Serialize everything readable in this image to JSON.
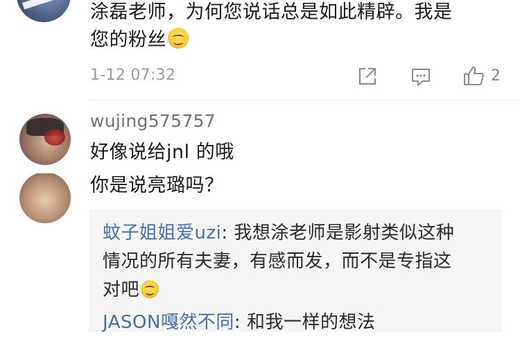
{
  "comment_prev": {
    "text_line1": "涂磊老师，为何您说话总是如此精辟。我是",
    "text_line2": "您的粉丝",
    "emoji": "smile-emoji",
    "time": "1-12 07:32",
    "actions": {
      "share_icon": "share-icon",
      "reply_icon": "comment-icon",
      "like_icon": "thumbs-up-icon",
      "like_count": "2"
    }
  },
  "comment_main": {
    "username": "wujing575757",
    "text_line1": "好像说给jnl 的哦",
    "text_line2": "你是说亮璐吗？",
    "replies": [
      {
        "author": "蚊子姐姐爱uzi",
        "separator": ": ",
        "text_part1": "我想涂老师是影射类似这种",
        "text_part2": "情况的所有夫妻，有感而发，而不是专指这",
        "text_part3": "对吧",
        "emoji": "smile-emoji"
      },
      {
        "author": "JASON嘎然不同",
        "separator": ": ",
        "text": "和我一样的想法"
      }
    ]
  },
  "colors": {
    "background": "#ffffff",
    "text": "#1a1a1a",
    "meta": "#9a9a9a",
    "reply_author": "#4a6ea9",
    "reply_bg": "#f5f5f5",
    "divider": "#e6e6e6"
  }
}
